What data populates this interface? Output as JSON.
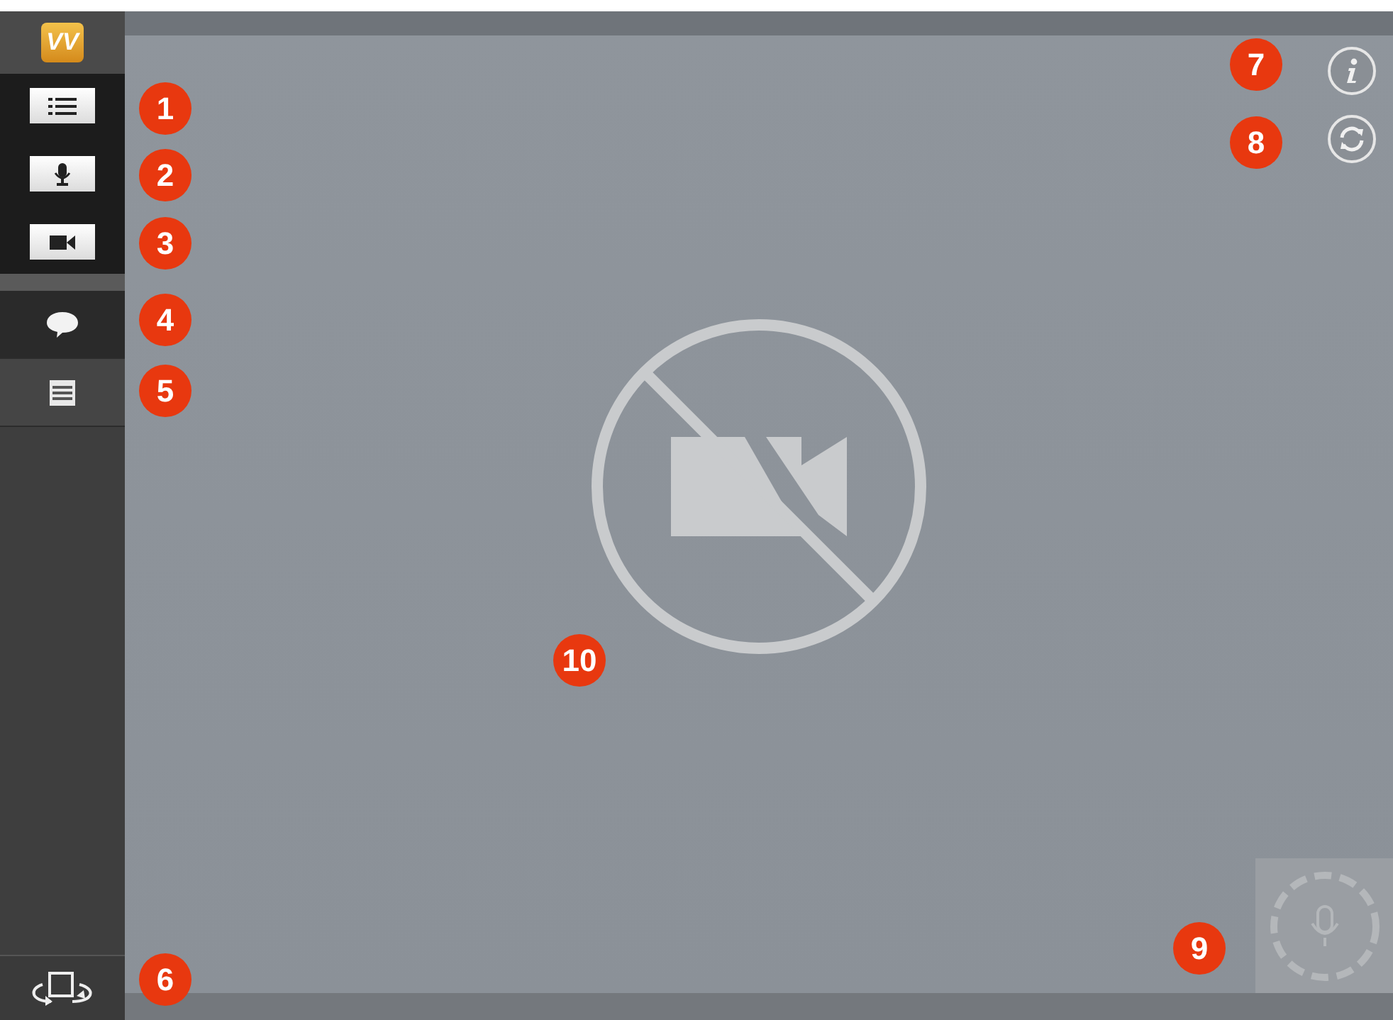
{
  "logo": {
    "text": "VV"
  },
  "sidebar": {
    "tool_buttons": [
      {
        "kind": "list"
      },
      {
        "kind": "mic"
      },
      {
        "kind": "camera"
      }
    ],
    "items": [
      {
        "kind": "chat",
        "selected": true
      },
      {
        "kind": "notes",
        "selected": false
      }
    ],
    "footer": {
      "kind": "rotate"
    }
  },
  "overlay_buttons": [
    {
      "kind": "info"
    },
    {
      "kind": "refresh"
    }
  ],
  "callouts": [
    "1",
    "2",
    "3",
    "4",
    "5",
    "6",
    "7",
    "8",
    "9",
    "10"
  ]
}
